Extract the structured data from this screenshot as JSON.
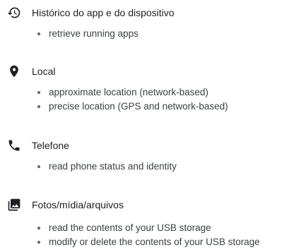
{
  "groups": [
    {
      "icon": "history-icon",
      "title": "Histórico do app e do dispositivo",
      "items": [
        "retrieve running apps"
      ]
    },
    {
      "icon": "location-pin-icon",
      "title": "Local",
      "items": [
        "approximate location (network-based)",
        "precise location (GPS and network-based)"
      ]
    },
    {
      "icon": "phone-icon",
      "title": "Telefone",
      "items": [
        "read phone status and identity"
      ]
    },
    {
      "icon": "photo-media-icon",
      "title": "Fotos/mídia/arquivos",
      "items": [
        "read the contents of your USB storage",
        "modify or delete the contents of your USB storage"
      ]
    }
  ],
  "colors": {
    "icon": "#202124",
    "title_text": "#202124",
    "item_text": "#3c4043",
    "bullet": "#5f6368",
    "background": "#ffffff"
  }
}
